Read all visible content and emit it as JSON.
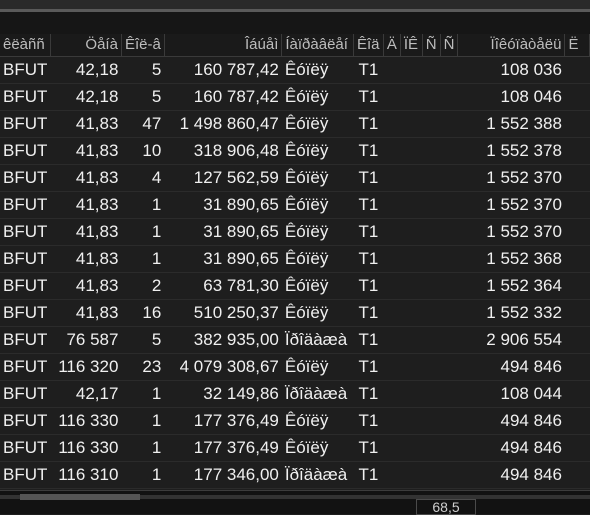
{
  "columns": [
    {
      "label": "êëàññ"
    },
    {
      "label": "Öåíà"
    },
    {
      "label": "Êîë-â"
    },
    {
      "label": "Îáúåì"
    },
    {
      "label": "Íàïðàâëåí"
    },
    {
      "label": "Êîä"
    },
    {
      "label": "Ä"
    },
    {
      "label": "ÏÊ"
    },
    {
      "label": "Ñ"
    },
    {
      "label": "Ñ"
    },
    {
      "label": "Ïîêóïàòåëü"
    },
    {
      "label": "Ë"
    }
  ],
  "rows": [
    {
      "cls": "BFUT",
      "price": "42,18",
      "qty": "5",
      "vol": "160 787,42",
      "dir": "Êóïëÿ",
      "code": "T1",
      "acc": "108 036"
    },
    {
      "cls": "BFUT",
      "price": "42,18",
      "qty": "5",
      "vol": "160 787,42",
      "dir": "Êóïëÿ",
      "code": "T1",
      "acc": "108 046"
    },
    {
      "cls": "BFUT",
      "price": "41,83",
      "qty": "47",
      "vol": "1 498 860,47",
      "dir": "Êóïëÿ",
      "code": "T1",
      "acc": "1 552 388"
    },
    {
      "cls": "BFUT",
      "price": "41,83",
      "qty": "10",
      "vol": "318 906,48",
      "dir": "Êóïëÿ",
      "code": "T1",
      "acc": "1 552 378"
    },
    {
      "cls": "BFUT",
      "price": "41,83",
      "qty": "4",
      "vol": "127 562,59",
      "dir": "Êóïëÿ",
      "code": "T1",
      "acc": "1 552 370"
    },
    {
      "cls": "BFUT",
      "price": "41,83",
      "qty": "1",
      "vol": "31 890,65",
      "dir": "Êóïëÿ",
      "code": "T1",
      "acc": "1 552 370"
    },
    {
      "cls": "BFUT",
      "price": "41,83",
      "qty": "1",
      "vol": "31 890,65",
      "dir": "Êóïëÿ",
      "code": "T1",
      "acc": "1 552 370"
    },
    {
      "cls": "BFUT",
      "price": "41,83",
      "qty": "1",
      "vol": "31 890,65",
      "dir": "Êóïëÿ",
      "code": "T1",
      "acc": "1 552 368"
    },
    {
      "cls": "BFUT",
      "price": "41,83",
      "qty": "2",
      "vol": "63 781,30",
      "dir": "Êóïëÿ",
      "code": "T1",
      "acc": "1 552 364"
    },
    {
      "cls": "BFUT",
      "price": "41,83",
      "qty": "16",
      "vol": "510 250,37",
      "dir": "Êóïëÿ",
      "code": "T1",
      "acc": "1 552 332"
    },
    {
      "cls": "BFUT",
      "price": "76 587",
      "qty": "5",
      "vol": "382 935,00",
      "dir": "Ïðîäàæà",
      "code": "T1",
      "acc": "2 906 554"
    },
    {
      "cls": "BFUT",
      "price": "116 320",
      "qty": "23",
      "vol": "4 079 308,67",
      "dir": "Êóïëÿ",
      "code": "T1",
      "acc": "494 846"
    },
    {
      "cls": "BFUT",
      "price": "42,17",
      "qty": "1",
      "vol": "32 149,86",
      "dir": "Ïðîäàæà",
      "code": "T1",
      "acc": "108 044"
    },
    {
      "cls": "BFUT",
      "price": "116 330",
      "qty": "1",
      "vol": "177 376,49",
      "dir": "Êóïëÿ",
      "code": "T1",
      "acc": "494 846"
    },
    {
      "cls": "BFUT",
      "price": "116 330",
      "qty": "1",
      "vol": "177 376,49",
      "dir": "Êóïëÿ",
      "code": "T1",
      "acc": "494 846"
    },
    {
      "cls": "BFUT",
      "price": "116 310",
      "qty": "1",
      "vol": "177 346,00",
      "dir": "Ïðîäàæà",
      "code": "T1",
      "acc": "494 846"
    }
  ],
  "footer": {
    "zoom": "68,5"
  }
}
